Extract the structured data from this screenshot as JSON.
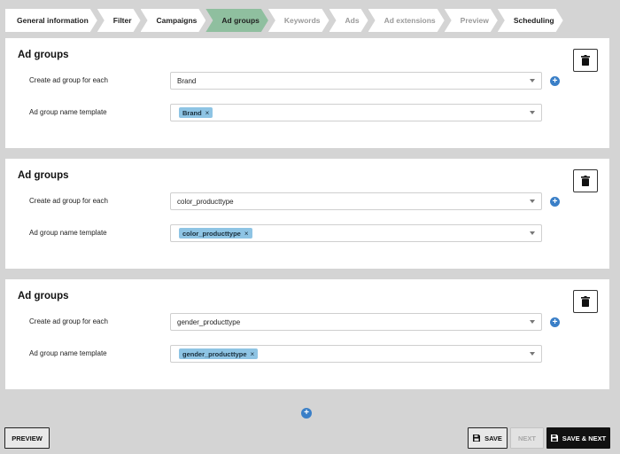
{
  "steps": [
    {
      "label": "General information",
      "state": "done"
    },
    {
      "label": "Filter",
      "state": "done"
    },
    {
      "label": "Campaigns",
      "state": "done"
    },
    {
      "label": "Ad groups",
      "state": "active"
    },
    {
      "label": "Keywords",
      "state": "future"
    },
    {
      "label": "Ads",
      "state": "future"
    },
    {
      "label": "Ad extensions",
      "state": "future"
    },
    {
      "label": "Preview",
      "state": "future"
    },
    {
      "label": "Scheduling",
      "state": "done"
    }
  ],
  "groups": [
    {
      "title": "Ad groups",
      "create_label": "Create ad group for each",
      "create_value": "Brand",
      "template_label": "Ad group name template",
      "template_tag": "Brand"
    },
    {
      "title": "Ad groups",
      "create_label": "Create ad group for each",
      "create_value": "color_producttype",
      "template_label": "Ad group name template",
      "template_tag": "color_producttype"
    },
    {
      "title": "Ad groups",
      "create_label": "Create ad group for each",
      "create_value": "gender_producttype",
      "template_label": "Ad group name template",
      "template_tag": "gender_producttype"
    }
  ],
  "icons": {
    "add": "plus-circle-icon",
    "delete": "trash-icon",
    "save": "floppy-disk-icon",
    "remove_tag": "close-icon",
    "dropdown": "chevron-down-icon"
  },
  "tag_remove_glyph": "×",
  "add_glyph": "+",
  "footer": {
    "preview_label": "PREVIEW",
    "save_label": "SAVE",
    "next_label": "NEXT",
    "save_next_label": "SAVE & NEXT"
  },
  "colors": {
    "active_step": "#8fbf9f",
    "tag": "#8ec4e4",
    "add_button": "#3a7fc7",
    "primary_button": "#111111"
  }
}
